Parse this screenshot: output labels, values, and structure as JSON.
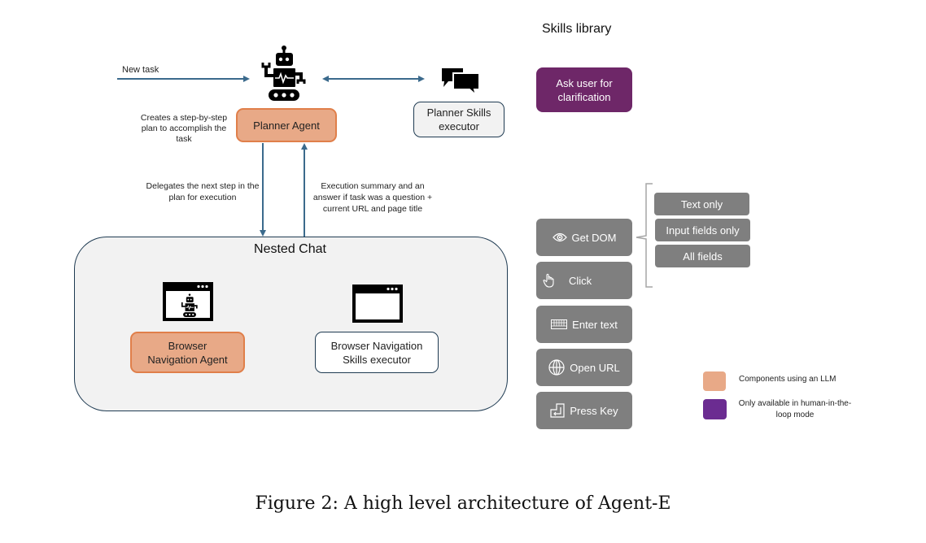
{
  "diagram": {
    "new_task_label": "New task",
    "planner_agent": "Planner Agent",
    "planner_note": "Creates a step-by-step plan to accomplish the task",
    "planner_skills_executor": "Planner Skills executor",
    "delegates_label": "Delegates the next step in the plan for execution",
    "summary_label": "Execution summary and an answer if task was a question + current URL and page title",
    "nested_chat_title": "Nested Chat",
    "browser_nav_agent": "Browser Navigation Agent",
    "browser_nav_executor": "Browser Navigation Skills executor"
  },
  "skills_library": {
    "title": "Skills library",
    "ask_user": "Ask user for clarification",
    "skills": [
      {
        "label": "Get DOM",
        "icon": "eye-icon"
      },
      {
        "label": "Click",
        "icon": "pointer-hand-icon"
      },
      {
        "label": "Enter text",
        "icon": "keyboard-icon"
      },
      {
        "label": "Open URL",
        "icon": "globe-icon"
      },
      {
        "label": "Press Key",
        "icon": "enter-key-icon"
      }
    ],
    "get_dom_options": [
      "Text only",
      "Input fields only",
      "All fields"
    ]
  },
  "legend": {
    "items": [
      {
        "label": "Components using an LLM",
        "color": "#e8a987"
      },
      {
        "label": "Only available in human-in-the-loop mode",
        "color": "#6b2c91"
      }
    ]
  },
  "colors": {
    "llm_fill": "#e8a987",
    "llm_border": "#e07f4a",
    "arrow": "#3b6a8c",
    "skill_gray": "#7f7f7f",
    "human_purple": "#6e2768",
    "legend_purple": "#6b2c91"
  },
  "caption": "Figure 2: A high level architecture of Agent-E"
}
